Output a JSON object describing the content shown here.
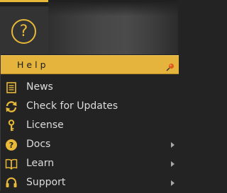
{
  "menu": {
    "title": "Help",
    "items": [
      {
        "label": "News",
        "icon": "news-icon",
        "submenu": false
      },
      {
        "label": "Check for Updates",
        "icon": "refresh-icon",
        "submenu": false
      },
      {
        "label": "License",
        "icon": "key-icon",
        "submenu": false
      },
      {
        "label": "Docs",
        "icon": "question-circle-icon",
        "submenu": true
      },
      {
        "label": "Learn",
        "icon": "book-icon",
        "submenu": true
      },
      {
        "label": "Support",
        "icon": "headset-icon",
        "submenu": true
      }
    ]
  },
  "colors": {
    "accent": "#e8b838",
    "menu_header": "#e4b43c",
    "background": "#232323",
    "text": "#dcdcdc",
    "pin": "#e05a1a"
  }
}
